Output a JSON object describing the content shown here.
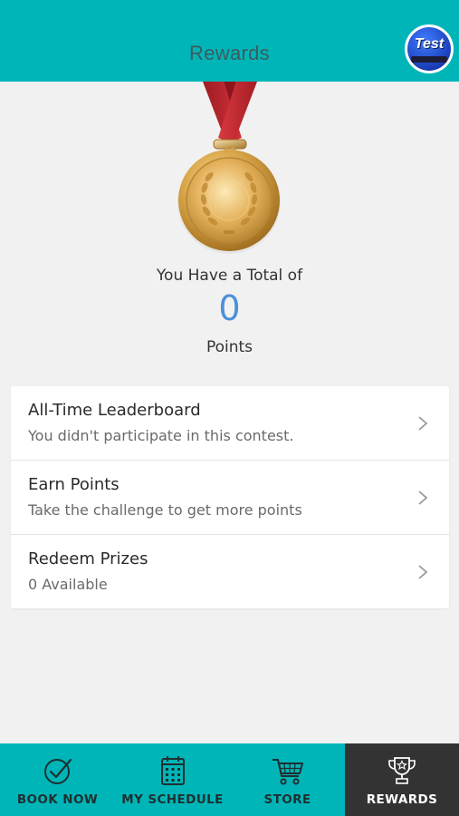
{
  "header": {
    "title": "Rewards",
    "avatar_text": "Test"
  },
  "summary": {
    "total_label": "You Have a Total of",
    "points": "0",
    "points_label": "Points"
  },
  "menu": [
    {
      "title": "All-Time Leaderboard",
      "subtitle": "You didn't participate in this contest.",
      "icon": "chevron-right-icon"
    },
    {
      "title": "Earn Points",
      "subtitle": "Take the challenge to get more points",
      "icon": "chevron-right-icon"
    },
    {
      "title": "Redeem Prizes",
      "subtitle": "0 Available",
      "icon": "chevron-right-icon"
    }
  ],
  "bottom_nav": [
    {
      "label": "BOOK NOW",
      "icon": "check-circle-icon",
      "active": false
    },
    {
      "label": "MY SCHEDULE",
      "icon": "calendar-icon",
      "active": false
    },
    {
      "label": "STORE",
      "icon": "cart-icon",
      "active": false
    },
    {
      "label": "REWARDS",
      "icon": "trophy-icon",
      "active": true
    }
  ],
  "colors": {
    "header_bg": "#00b5b8",
    "nav_bg": "#00b5b8",
    "nav_active_bg": "#333333",
    "points_color": "#4a90d9",
    "page_bg": "#f1f1f1"
  }
}
